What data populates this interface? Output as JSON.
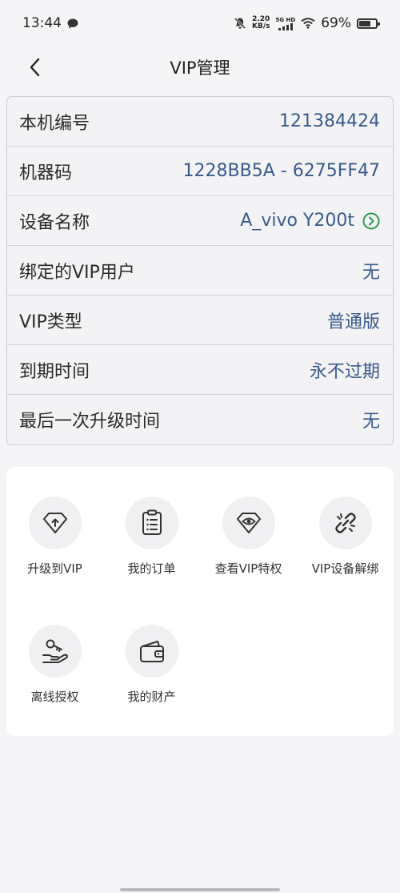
{
  "status_bar": {
    "time": "13:44",
    "net_speed_value": "2.20",
    "net_speed_unit": "KB/s",
    "network_type": "5G HD",
    "battery": "69%",
    "battery_level": 0.69
  },
  "nav": {
    "title": "VIP管理"
  },
  "info_rows": [
    {
      "label": "本机编号",
      "value": "121384424"
    },
    {
      "label": "机器码",
      "value": "1228BB5A - 6275FF47"
    },
    {
      "label": "设备名称",
      "value": "A_vivo Y200t",
      "icon": "chevron-right-circle-icon"
    },
    {
      "label": "绑定的VIP用户",
      "value": "无"
    },
    {
      "label": "VIP类型",
      "value": "普通版"
    },
    {
      "label": "到期时间",
      "value": "永不过期"
    },
    {
      "label": "最后一次升级时间",
      "value": "无"
    }
  ],
  "menu": [
    {
      "label": "升级到VIP",
      "icon": "diamond-upgrade-icon"
    },
    {
      "label": "我的订单",
      "icon": "clipboard-list-icon"
    },
    {
      "label": "查看VIP特权",
      "icon": "diamond-eye-icon"
    },
    {
      "label": "VIP设备解绑",
      "icon": "unlink-icon"
    },
    {
      "label": "离线授权",
      "icon": "key-hand-icon"
    },
    {
      "label": "我的财产",
      "icon": "wallet-icon"
    }
  ],
  "colors": {
    "accent_value": "#3a5a8c",
    "green_icon": "#2e9a4a"
  }
}
